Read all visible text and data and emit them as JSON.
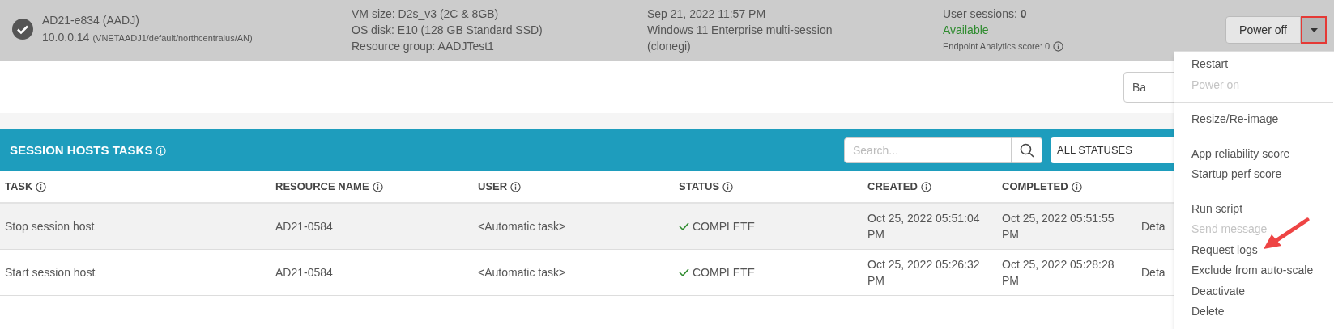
{
  "host": {
    "name": "AD21-e834 (AADJ)",
    "ip": "10.0.0.14",
    "network": "(VNETAADJ1/default/northcentralus/AN)",
    "vm_size": "VM size: D2s_v3 (2C & 8GB)",
    "os_disk": "OS disk: E10 (128 GB Standard SSD)",
    "resource_group": "Resource group: AADJTest1",
    "date": "Sep 21, 2022 11:57 PM",
    "os": "Windows 11 Enterprise multi-session",
    "image": "(clonegi)",
    "sessions_label": "User sessions:",
    "sessions_value": "0",
    "availability": "Available",
    "score": "Endpoint Analytics score: 0",
    "power_button": "Power off"
  },
  "toolbar": {
    "back_button": "Ba"
  },
  "tasks": {
    "title": "SESSION HOSTS TASKS",
    "search": {
      "placeholder": "Search..."
    },
    "status_filter": "ALL STATUSES",
    "columns": [
      "TASK",
      "RESOURCE NAME",
      "USER",
      "STATUS",
      "CREATED",
      "COMPLETED"
    ],
    "rows": [
      {
        "task": "Stop session host",
        "resource": "AD21-0584",
        "user": "<Automatic task>",
        "status": "COMPLETE",
        "created": "Oct 25, 2022 05:51:04 PM",
        "completed": "Oct 25, 2022 05:51:55 PM",
        "link": "Deta"
      },
      {
        "task": "Start session host",
        "resource": "AD21-0584",
        "user": "<Automatic task>",
        "status": "COMPLETE",
        "created": "Oct 25, 2022 05:26:32 PM",
        "completed": "Oct 25, 2022 05:28:28 PM",
        "link": "Deta"
      }
    ]
  },
  "menu": [
    {
      "kind": "item",
      "label": "Restart",
      "disabled": false
    },
    {
      "kind": "item",
      "label": "Power on",
      "disabled": true
    },
    {
      "kind": "divider"
    },
    {
      "kind": "item",
      "label": "Resize/Re-image",
      "disabled": false
    },
    {
      "kind": "divider"
    },
    {
      "kind": "item",
      "label": "App reliability score",
      "disabled": false
    },
    {
      "kind": "item",
      "label": "Startup perf score",
      "disabled": false
    },
    {
      "kind": "divider"
    },
    {
      "kind": "item",
      "label": "Run script",
      "disabled": false
    },
    {
      "kind": "item",
      "label": "Send message",
      "disabled": true
    },
    {
      "kind": "item",
      "label": "Request logs",
      "disabled": false
    },
    {
      "kind": "item",
      "label": "Exclude from auto-scale",
      "disabled": false
    },
    {
      "kind": "item",
      "label": "Deactivate",
      "disabled": false
    },
    {
      "kind": "item",
      "label": "Delete",
      "disabled": false
    }
  ]
}
